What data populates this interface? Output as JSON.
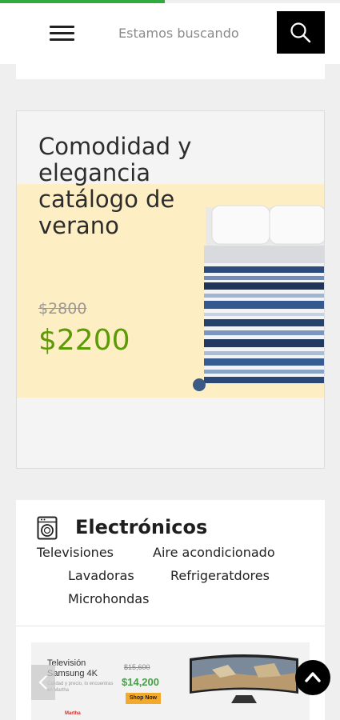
{
  "page": {
    "scroll_progress": 0.485,
    "accent_color": "#2faa3c"
  },
  "header": {
    "menu_icon": "hamburger-menu-icon",
    "search": {
      "placeholder": "Estamos buscando",
      "value": "",
      "button_icon": "search-icon"
    }
  },
  "promo": {
    "title_lines": [
      "Comodidad y",
      "elegancia",
      "catálogo de",
      "verano"
    ],
    "old_price": "$2800",
    "new_price": "$2200",
    "price_color": "#5c9a06",
    "image": "striped-bed-image"
  },
  "category": {
    "icon": "washing-machine-icon",
    "title": "Electrónicos",
    "links": [
      "Televisiones",
      "Aire acondicionado",
      "Lavadoras",
      "Refrigeratdores",
      "Microhondas"
    ],
    "banner": {
      "title_lines": [
        "Televisión",
        "Samsung 4K"
      ],
      "subtitle": "Calidad y precio, lo encuentras en Martha",
      "old_price": "$15,600",
      "price": "$14,200",
      "cta": "Shop Now",
      "logo": "Martha",
      "prev_icon": "chevron-left-icon",
      "image": "curved-tv-image"
    }
  },
  "back_to_top": {
    "icon": "chevron-up-icon"
  }
}
